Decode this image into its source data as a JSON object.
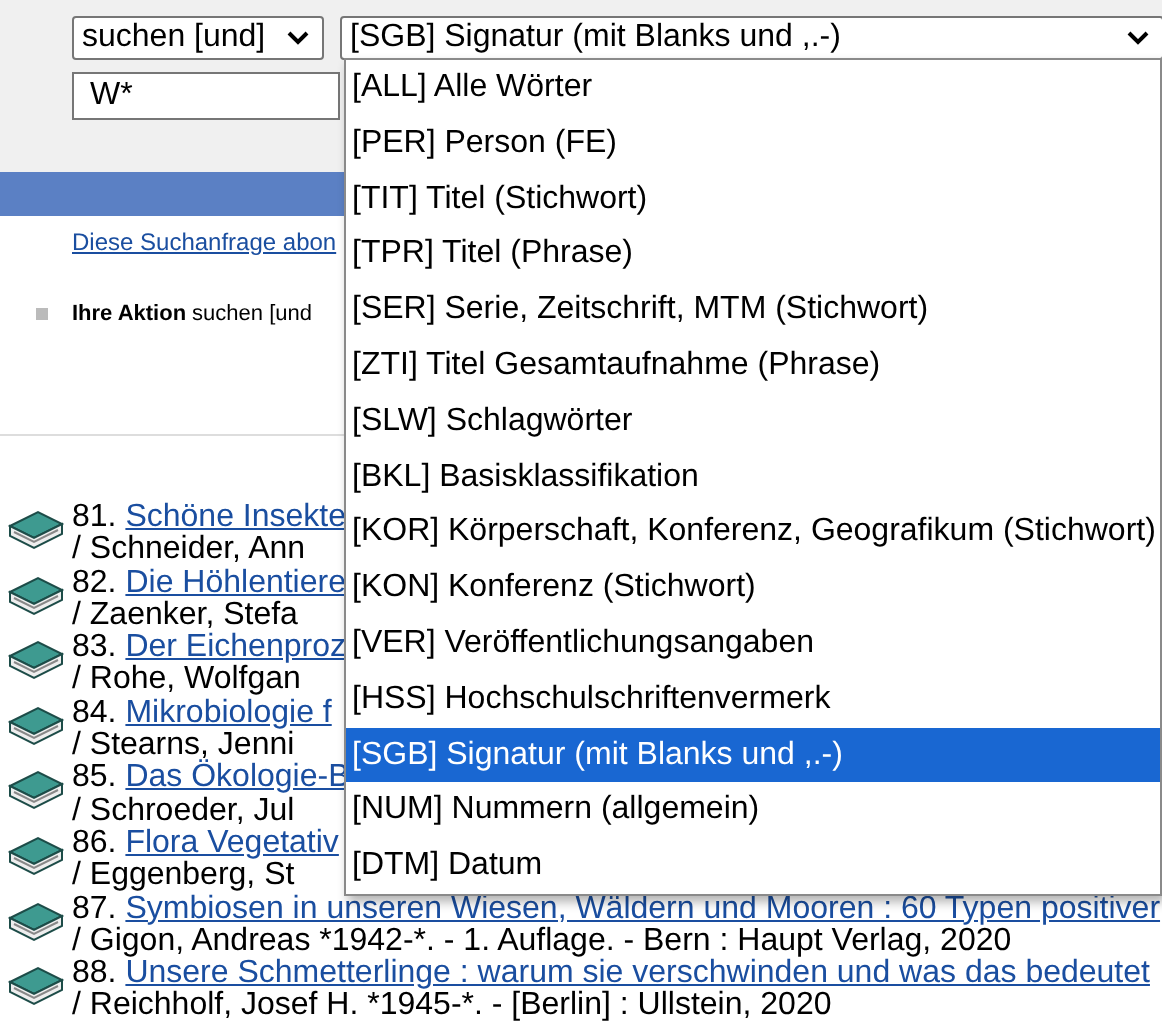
{
  "search": {
    "operator": "suchen [und]",
    "field": "[SGB] Signatur (mit Blanks und ,.-)",
    "term": "W*"
  },
  "field_menu": [
    {
      "label": "[ALL] Alle Wörter",
      "selected": false
    },
    {
      "label": "[PER] Person (FE)",
      "selected": false
    },
    {
      "label": "[TIT] Titel (Stichwort)",
      "selected": false
    },
    {
      "label": "[TPR] Titel (Phrase)",
      "selected": false
    },
    {
      "label": "[SER] Serie, Zeitschrift, MTM (Stichwort)",
      "selected": false
    },
    {
      "label": "[ZTI] Titel Gesamtaufnahme (Phrase)",
      "selected": false
    },
    {
      "label": "[SLW] Schlagwörter",
      "selected": false
    },
    {
      "label": "[BKL] Basisklassifikation",
      "selected": false
    },
    {
      "label": "[KOR] Körperschaft, Konferenz, Geografikum (Stichwort)",
      "selected": false
    },
    {
      "label": "[KON] Konferenz (Stichwort)",
      "selected": false
    },
    {
      "label": "[VER] Veröffentlichungsangaben",
      "selected": false
    },
    {
      "label": "[HSS] Hochschulschriftenvermerk",
      "selected": false
    },
    {
      "label": "[SGB] Signatur (mit Blanks und ,.-)",
      "selected": true
    },
    {
      "label": "[NUM] Nummern (allgemein)",
      "selected": false
    },
    {
      "label": "[DTM] Datum",
      "selected": false
    }
  ],
  "subscribe_link": "Diese Suchanfrage abon",
  "action": {
    "label": "Ihre Aktion",
    "text": "suchen [und"
  },
  "results": [
    {
      "number": "81.",
      "title": "Schöne Insekte",
      "details": "/ Schneider, Ann"
    },
    {
      "number": "82.",
      "title": "Die Höhlentiere",
      "details": "/ Zaenker, Stefa"
    },
    {
      "number": "83.",
      "title": "Der Eichenproz",
      "details": "/ Rohe, Wolfgan"
    },
    {
      "number": "84.",
      "title": "Mikrobiologie f",
      "details": "/ Stearns, Jenni"
    },
    {
      "number": "85.",
      "title": "Das Ökologie-B",
      "details": "/ Schroeder, Jul"
    },
    {
      "number": "86.",
      "title": "Flora Vegetativ",
      "details": "/ Eggenberg, St"
    },
    {
      "number": "87.",
      "title": "Symbiosen in unseren Wiesen, Wäldern und Mooren : 60 Typen positiver",
      "details": "/ Gigon, Andreas *1942-*. - 1. Auflage. - Bern : Haupt Verlag, 2020"
    },
    {
      "number": "88.",
      "title": "Unsere Schmetterlinge : warum sie verschwinden und was das bedeutet",
      "details": "/ Reichholf, Josef H. *1945-*. - [Berlin] : Ullstein, 2020"
    }
  ]
}
